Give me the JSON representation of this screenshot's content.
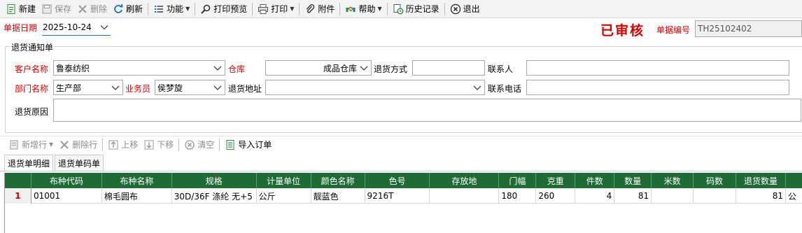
{
  "toolbar": {
    "new": "新建",
    "save": "保存",
    "delete": "删除",
    "refresh": "刷新",
    "function": "功能",
    "print_preview": "打印预览",
    "print": "打印",
    "attachment": "附件",
    "help": "帮助",
    "history": "历史记录",
    "exit": "退出"
  },
  "header": {
    "date_label": "单据日期",
    "date_value": "2025-10-24",
    "approved_stamp": "已审核",
    "docno_label": "单据编号",
    "docno_value": "TH25102402"
  },
  "form": {
    "group_title": "退货通知单",
    "customer_label": "客户名称",
    "customer_value": "鲁泰纺织",
    "warehouse_label": "仓库",
    "warehouse_value": "成品仓库",
    "return_method_label": "退货方式",
    "return_method_value": "",
    "contact_label": "联系人",
    "contact_value": "",
    "dept_label": "部门名称",
    "dept_value": "生产部",
    "salesman_label": "业务员",
    "salesman_value": "侯梦旋",
    "return_addr_label": "退货地址",
    "return_addr_value": "",
    "phone_label": "联系电话",
    "phone_value": "",
    "reason_label": "退货原因",
    "reason_value": ""
  },
  "subtoolbar": {
    "add_row": "新增行",
    "delete_row": "删除行",
    "move_up": "上移",
    "move_down": "下移",
    "clear": "清空",
    "import_order": "导入订单"
  },
  "tabs": [
    "退货单明细",
    "退货单码单"
  ],
  "grid": {
    "columns": [
      "",
      "布种代码",
      "布种名称",
      "规格",
      "计量单位",
      "颜色名称",
      "色号",
      "存放地",
      "门幅",
      "克重",
      "件数",
      "数量",
      "米数",
      "码数",
      "退货数量",
      ""
    ],
    "rows": [
      [
        "1",
        "01001",
        "棉毛圆布",
        "30D/36F  涤纶   无+5",
        "公斤",
        "靓蓝色",
        "9216T",
        "",
        "180",
        "260",
        "4",
        "81",
        "",
        "",
        "81",
        "公"
      ]
    ]
  }
}
